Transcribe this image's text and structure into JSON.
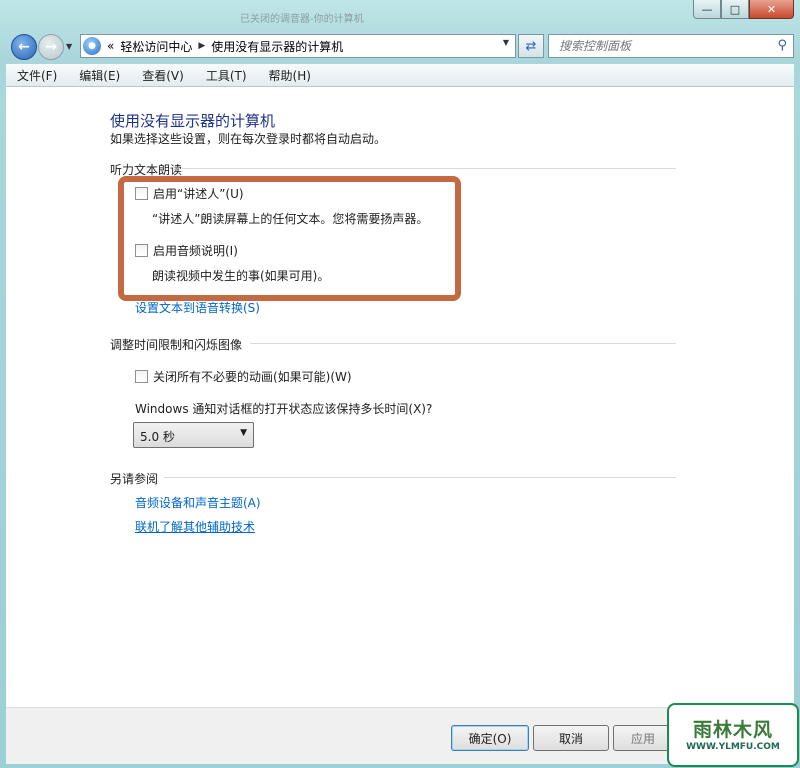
{
  "window": {
    "title": "已关闭的调音器-你的计算机",
    "min_glyph": "—",
    "max_glyph": "□",
    "close_glyph": "✕"
  },
  "nav": {
    "address_prefix": "«",
    "breadcrumbs": [
      "轻松访问中心",
      "使用没有显示器的计算机"
    ],
    "search_placeholder": "搜索控制面板"
  },
  "menu": [
    "文件(F)",
    "编辑(E)",
    "查看(V)",
    "工具(T)",
    "帮助(H)"
  ],
  "page": {
    "title": "使用没有显示器的计算机",
    "subtitle": "如果选择这些设置，则在每次登录时都将自动启动。",
    "section_audio": "听力文本朗读",
    "narrator_label": "启用“讲述人”(U)",
    "narrator_desc": "“讲述人”朗读屏幕上的任何文本。您将需要扬声器。",
    "audio_desc_label": "启用音频说明(I)",
    "audio_desc_desc": "朗读视频中发生的事(如果可用)。",
    "tts_link": "设置文本到语音转换(S)",
    "section_time": "调整时间限制和闪烁图像",
    "animations_label": "关闭所有不必要的动画(如果可能)(W)",
    "notify_question": "Windows 通知对话框的打开状态应该保持多长时间(X)?",
    "notify_value": "5.0 秒",
    "section_see_also": "另请参阅",
    "see_also_links": [
      "音频设备和声音主题(A)",
      "联机了解其他辅助技术"
    ]
  },
  "buttons": {
    "ok": "确定(O)",
    "cancel": "取消",
    "apply": "应用"
  },
  "watermark": {
    "brand": "雨林木风",
    "url": "WWW.YLMFU.COM"
  },
  "colors": {
    "highlight_box": "#c46a42",
    "link": "#0066cc",
    "title": "#1e3287"
  }
}
